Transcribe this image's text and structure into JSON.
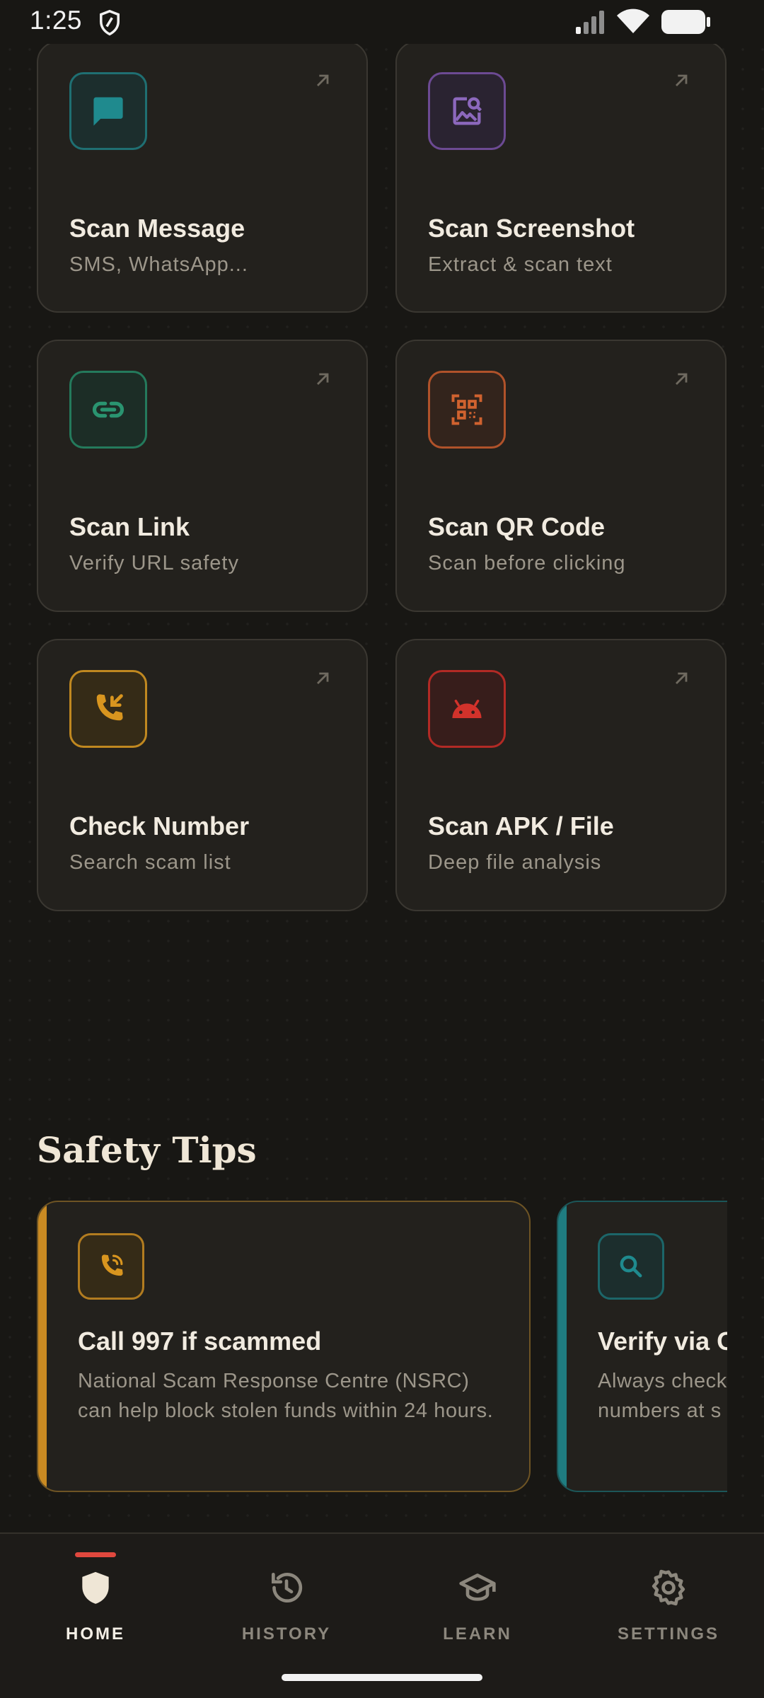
{
  "status_bar": {
    "time": "1:25"
  },
  "feature_cards": [
    {
      "title": "Scan Message",
      "subtitle": "SMS, WhatsApp...",
      "icon": "message-icon",
      "color": "#1f7c80"
    },
    {
      "title": "Scan Screenshot",
      "subtitle": "Extract & scan text",
      "icon": "image-search-icon",
      "color": "#7a4fa8"
    },
    {
      "title": "Scan Link",
      "subtitle": "Verify URL safety",
      "icon": "link-icon",
      "color": "#2a8a68"
    },
    {
      "title": "Scan QR Code",
      "subtitle": "Scan before clicking",
      "icon": "qr-code-icon",
      "color": "#c2592a"
    },
    {
      "title": "Check Number",
      "subtitle": "Search scam list",
      "icon": "phone-incoming-icon",
      "color": "#d18f1e"
    },
    {
      "title": "Scan APK / File",
      "subtitle": "Deep file analysis",
      "icon": "android-icon",
      "color": "#c6302a"
    }
  ],
  "safety_tips": {
    "title": "Safety Tips",
    "tips": [
      {
        "title": "Call 997 if scammed",
        "body": "National Scam Response Centre (NSRC) can help block stolen funds within 24 hours.",
        "icon": "phone-call-icon",
        "color": "#c98a22"
      },
      {
        "title": "Verify via Official Channels",
        "body": "Always check official numbers at s",
        "icon": "search-icon",
        "color": "#1f7c80"
      }
    ]
  },
  "bottom_nav": {
    "items": [
      {
        "label": "HOME",
        "icon": "shield-icon",
        "active": true
      },
      {
        "label": "HISTORY",
        "icon": "history-icon",
        "active": false
      },
      {
        "label": "LEARN",
        "icon": "graduation-cap-icon",
        "active": false
      },
      {
        "label": "SETTINGS",
        "icon": "gear-icon",
        "active": false
      }
    ]
  }
}
